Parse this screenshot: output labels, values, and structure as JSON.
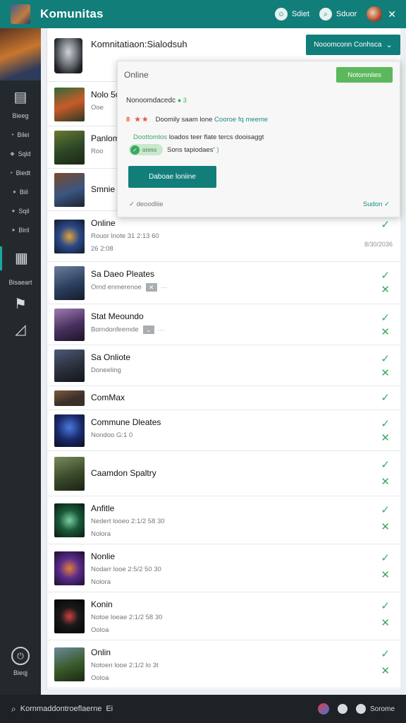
{
  "topbar": {
    "title": "Komunitas",
    "action1": "Sdiet",
    "action2": "Sduor"
  },
  "sidebar": {
    "items": [
      "Bieeg",
      "Bilei",
      "Sqld",
      "Biedt",
      "Biil",
      "Sqil",
      "Biril"
    ],
    "labeled": "Bisaeart",
    "bottom_label": "Bieqj"
  },
  "header": {
    "title": "Komnitatiaon:Sialodsuh",
    "button_label": "Nooomconn Conhsca"
  },
  "popup": {
    "status": "Online",
    "pill_label": "Notomniies",
    "line1": "Nonoomdacedc",
    "line1_marks": "● 3",
    "line2_stars": "8 ★★",
    "line2_text": "Doomily saam lone",
    "line2_link": "Cooroe fq meeme",
    "line3_green": "Doottomlos",
    "line3_text": "loados teer  flate  tercs  dooisaggt",
    "toggle_text": "onmo",
    "line4_text": "Sons  tapiodaes'",
    "line4_g": ")",
    "button_label": "Daboae loniine",
    "foot_left": "✓ deoodliie",
    "foot_right": "Sudon ✓"
  },
  "rows": [
    {
      "title": "Nolo 5o",
      "sub": "Ooe",
      "thumb": "orange"
    },
    {
      "title": "Panlom",
      "sub": "Roo",
      "thumb": "green"
    },
    {
      "title": "Smnie",
      "sub": "",
      "thumb": "copper"
    },
    {
      "title": "Online",
      "sub": "Rouor lnote 31 2:13  60",
      "sub2": "26 2:08",
      "date": "8/30/2036",
      "thumb": "blue"
    },
    {
      "title": "Sa Daeo Pleates",
      "sub": "Ornd enmerenoe",
      "thumb": "steel"
    },
    {
      "title": "Stat Meoundo",
      "sub": "Borndonfeemde",
      "thumb": "purple"
    },
    {
      "title": "Sa Onliote",
      "sub": "Doneeling",
      "thumb": "night"
    },
    {
      "title": "ComMax",
      "sub": "",
      "thumb": "dusk"
    },
    {
      "title": "Commune Dleates",
      "sub": "Nondoo  G:1 0",
      "thumb": "space"
    },
    {
      "title": "Caamdon Spaltry",
      "sub": "",
      "thumb": "olive"
    },
    {
      "title": "Anfitle",
      "sub": "Nedert looeo 2:1/2 58 30",
      "sub2": "Nolora",
      "thumb": "jade"
    },
    {
      "title": "Nonlie",
      "sub": "Nodarr looe 2:5/2 50 30",
      "sub2": "Nolora",
      "thumb": "violet"
    },
    {
      "title": "Konin",
      "sub": "Notoe loeae  2:1/2 58 30",
      "sub2": "Ooloa",
      "thumb": "black"
    },
    {
      "title": "Onlin",
      "sub": "Notoen looe  2:1/2 lo 3t",
      "sub2": "Ooloa",
      "thumb": "forest"
    }
  ],
  "bottombar": {
    "text": "Kornmaddontroeflaerne",
    "suffix": "Ei",
    "right_label": "Sorome"
  },
  "colors": {
    "accent": "#127e7a",
    "success": "#3aa862",
    "sidebar": "#24292d"
  }
}
